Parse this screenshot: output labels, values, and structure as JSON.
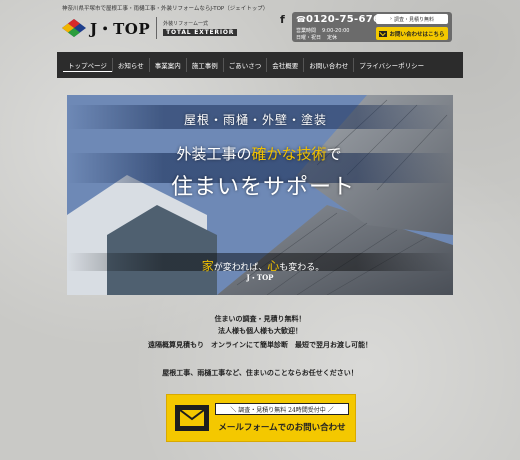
{
  "header": {
    "tagline": "神奈川県平塚市で屋根工事・雨樋工事・外装リフォームならJ-TOP（ジェイトップ）",
    "logo_text": "J・TOP",
    "logo_sub_top": "外装リフォーム一式",
    "logo_sub_bottom": "TOTAL EXTERIOR",
    "facebook": "f",
    "phone": "0120-75-6760",
    "hours_label1": "営業時間",
    "hours_value1": "9:00-20:00",
    "hours_label2": "日曜・祝日",
    "hours_value2": "定休",
    "survey_button": "調査・見積り無料",
    "contact_button": "お問い合わせはこちら"
  },
  "nav": {
    "items": [
      {
        "label": "トップページ"
      },
      {
        "label": "お知らせ"
      },
      {
        "label": "事業案内"
      },
      {
        "label": "施工事例"
      },
      {
        "label": "ごあいさつ"
      },
      {
        "label": "会社概要"
      },
      {
        "label": "お問い合わせ"
      },
      {
        "label": "プライバシーポリシー"
      }
    ]
  },
  "hero": {
    "category": "屋根・雨樋・外壁・塗装",
    "line1_pre": "外装工事の",
    "line1_highlight": "確かな技術",
    "line1_post": "で",
    "line2": "住まいをサポート",
    "slogan_a": "家",
    "slogan_b": "が変われば、",
    "slogan_c": "心",
    "slogan_d": "も変わる。",
    "logo": "J・TOP"
  },
  "messages": {
    "m1": "住まいの調査・見積り無料！",
    "m2": "法人様も個人様も大歓迎！",
    "m3": "遠隔概算見積もり　オンラインにて簡単診断　最短で翌月お渡し可能！",
    "m4": "屋根工事、雨樋工事など、住まいのことならお任せください！"
  },
  "cta": {
    "sub": "＼ 調査・見積り無料 24時間受付中 ／",
    "main": "メールフォームでのお問い合わせ"
  },
  "colors": {
    "accent": "#f4c800",
    "nav_bg": "#2c2c2c",
    "contact_bg": "#6b6b6b"
  }
}
